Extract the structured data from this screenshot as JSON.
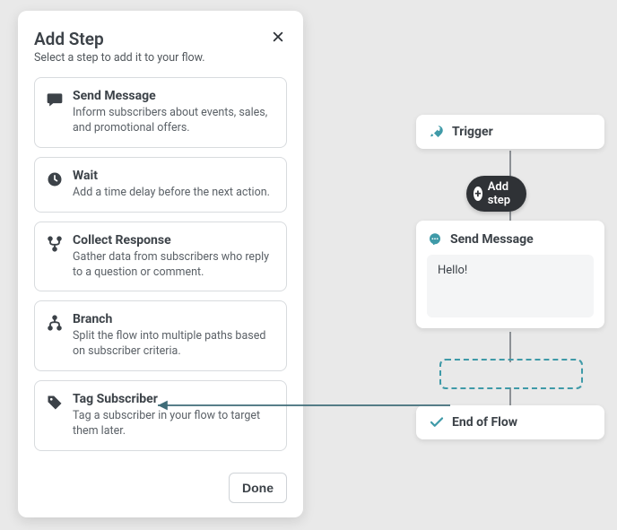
{
  "modal": {
    "title": "Add Step",
    "subtitle": "Select a step to add it to your flow.",
    "done_label": "Done",
    "steps": [
      {
        "name": "Send Message",
        "desc": "Inform subscribers about events, sales, and promotional offers.",
        "icon": "chat-icon"
      },
      {
        "name": "Wait",
        "desc": "Add a time delay before the next action.",
        "icon": "clock-icon"
      },
      {
        "name": "Collect Response",
        "desc": "Gather data from subscribers who reply to a question or comment.",
        "icon": "branch-merge-icon"
      },
      {
        "name": "Branch",
        "desc": "Split the flow into multiple paths based on subscriber criteria.",
        "icon": "branch-split-icon"
      },
      {
        "name": "Tag Subscriber",
        "desc": "Tag a subscriber in your flow to target them later.",
        "icon": "tag-icon"
      }
    ]
  },
  "flow": {
    "trigger_label": "Trigger",
    "add_step_label": "Add step",
    "send_message_label": "Send Message",
    "message_body": "Hello!",
    "end_label": "End of Flow"
  },
  "colors": {
    "accent": "#3f9aa8",
    "dark": "#3c4248"
  }
}
